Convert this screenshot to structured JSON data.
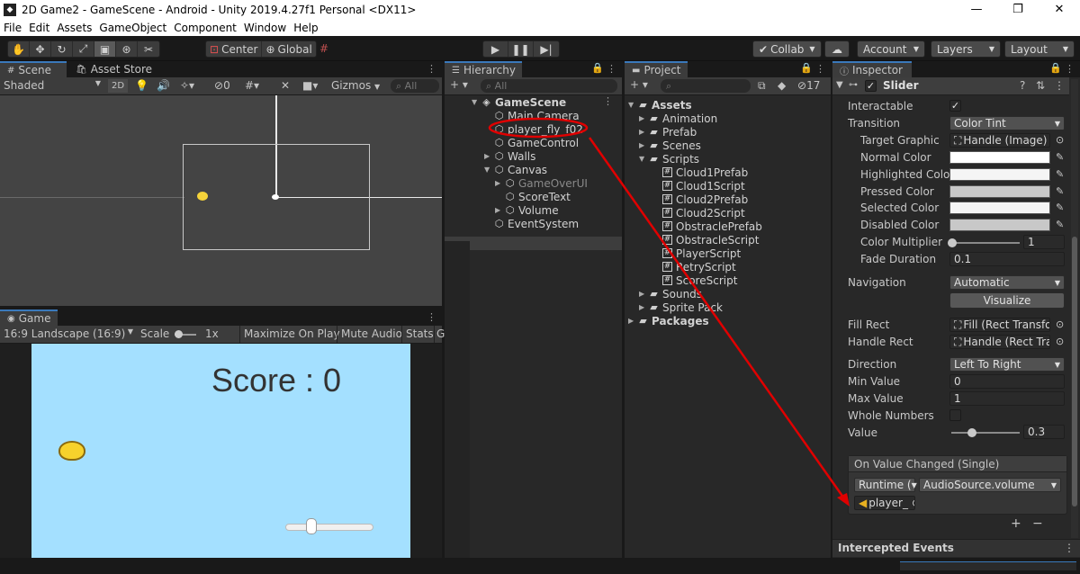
{
  "window": {
    "title": "2D Game2 - GameScene - Android - Unity 2019.4.27f1 Personal <DX11>",
    "minimize": "—",
    "maximize": "❐",
    "close": "✕"
  },
  "menu": [
    "File",
    "Edit",
    "Assets",
    "GameObject",
    "Component",
    "Window",
    "Help"
  ],
  "toolbar": {
    "pivot": "Center",
    "space": "Global",
    "collab": "Collab",
    "account": "Account",
    "layers": "Layers",
    "layout": "Layout"
  },
  "scene": {
    "tab_scene": "Scene",
    "tab_asset_store": "Asset Store",
    "shading": "Shaded",
    "mode_2d": "2D",
    "hidden_count": "0",
    "gizmos": "Gizmos",
    "search_placeholder": "All"
  },
  "game": {
    "tab": "Game",
    "aspect": "16:9 Landscape (16:9)",
    "scale_label": "Scale",
    "scale_value": "1x",
    "maximize": "Maximize On Play",
    "mute": "Mute Audio",
    "stats": "Stats",
    "gizmos_cut": "G",
    "score_text": "Score : 0",
    "slider_value": 0.3
  },
  "hierarchy": {
    "tab": "Hierarchy",
    "search_placeholder": "All",
    "scene_name": "GameScene",
    "items": [
      {
        "label": "Main Camera"
      },
      {
        "label": "player_fly_f02"
      },
      {
        "label": "GameControl"
      },
      {
        "label": "Walls"
      },
      {
        "label": "Canvas"
      },
      {
        "label": "GameOverUI"
      },
      {
        "label": "ScoreText"
      },
      {
        "label": "Volume"
      },
      {
        "label": "EventSystem"
      }
    ]
  },
  "project": {
    "tab": "Project",
    "hidden_count": "17",
    "items": [
      {
        "label": "Assets"
      },
      {
        "label": "Animation"
      },
      {
        "label": "Prefab"
      },
      {
        "label": "Scenes"
      },
      {
        "label": "Scripts"
      },
      {
        "label": "Cloud1Prefab"
      },
      {
        "label": "Cloud1Script"
      },
      {
        "label": "Cloud2Prefab"
      },
      {
        "label": "Cloud2Script"
      },
      {
        "label": "ObstraclePrefab"
      },
      {
        "label": "ObstracleScript"
      },
      {
        "label": "PlayerScript"
      },
      {
        "label": "RetryScript"
      },
      {
        "label": "ScoreScript"
      },
      {
        "label": "Sounds"
      },
      {
        "label": "Sprite Pack"
      },
      {
        "label": "Packages"
      }
    ]
  },
  "inspector": {
    "tab": "Inspector",
    "component": "Slider",
    "interactable": "Interactable",
    "transition": "Transition",
    "transition_value": "Color Tint",
    "target_graphic": "Target Graphic",
    "target_graphic_value": "Handle (Image)",
    "normal_color": "Normal Color",
    "highlighted_color": "Highlighted Color",
    "pressed_color": "Pressed Color",
    "selected_color": "Selected Color",
    "disabled_color": "Disabled Color",
    "color_multiplier": "Color Multiplier",
    "color_multiplier_value": "1",
    "fade_duration": "Fade Duration",
    "fade_duration_value": "0.1",
    "navigation": "Navigation",
    "navigation_value": "Automatic",
    "visualize": "Visualize",
    "fill_rect": "Fill Rect",
    "fill_rect_value": "Fill (Rect Transfor",
    "handle_rect": "Handle Rect",
    "handle_rect_value": "Handle (Rect Tran",
    "direction": "Direction",
    "direction_value": "Left To Right",
    "min_value": "Min Value",
    "min_value_value": "0",
    "max_value": "Max Value",
    "max_value_value": "1",
    "whole_numbers": "Whole Numbers",
    "value": "Value",
    "value_value": "0.3",
    "event_header": "On Value Changed (Single)",
    "runtime": "Runtime (",
    "function": "AudioSource.volume",
    "object": "player_",
    "plus": "+",
    "minus": "−",
    "intercepted": "Intercepted Events",
    "colors": {
      "normal": "#ffffff",
      "highlighted": "#f5f5f5",
      "pressed": "#c8c8c8",
      "selected": "#f5f5f5",
      "disabled": "#c8c8c8"
    }
  },
  "annotation": {
    "color": "#e00000"
  }
}
